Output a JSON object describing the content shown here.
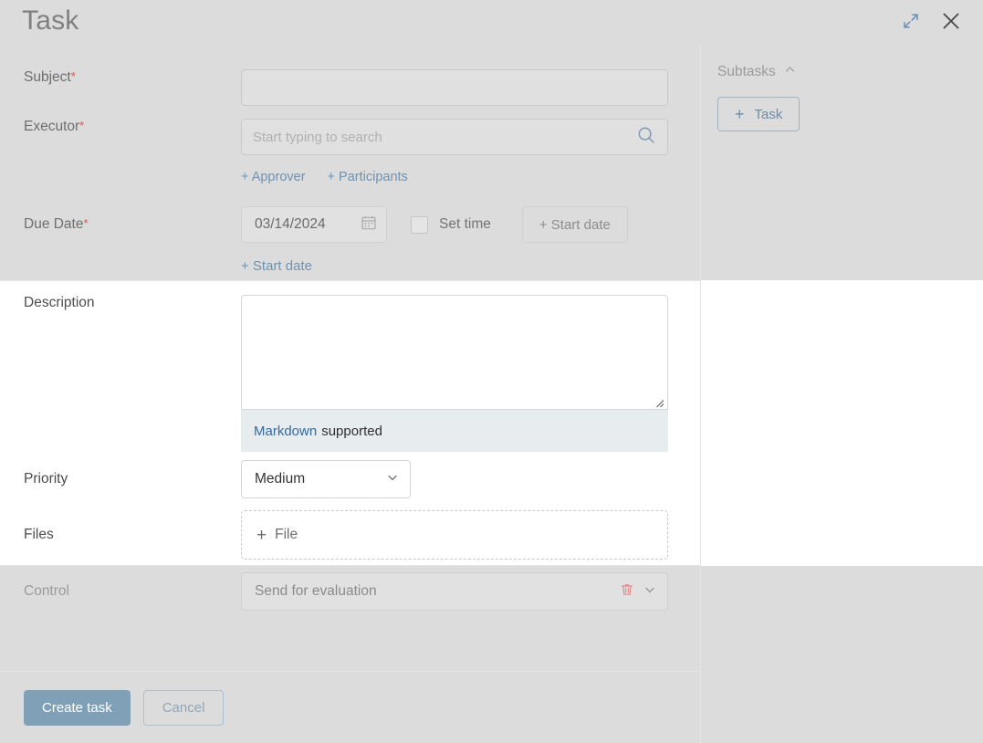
{
  "header": {
    "title": "Task",
    "expand_icon": "expand-diagonal-icon",
    "close_icon": "close-icon"
  },
  "form": {
    "subject": {
      "label": "Subject",
      "required_marker": "*",
      "value": "",
      "placeholder": ""
    },
    "executor": {
      "label": "Executor",
      "required_marker": "*",
      "value": "",
      "placeholder": "Start typing to search",
      "search_icon": "search-icon"
    },
    "people_links": [
      {
        "label": "+ Approver"
      },
      {
        "label": "+ Participants"
      }
    ],
    "due_date": {
      "label": "Due Date",
      "required_marker": "*",
      "value": "03/14/2024",
      "calendar_icon": "calendar-icon",
      "set_time_label": "Set time",
      "set_time_checked": false,
      "start_date_button": "+ Start date",
      "start_date_link": "+ Start date"
    },
    "description": {
      "label": "Description",
      "value": "",
      "markdown_link": "Markdown",
      "markdown_rest": "supported",
      "resize_grip": "resize-grip-icon"
    },
    "priority": {
      "label": "Priority",
      "value": "Medium",
      "chevron_icon": "chevron-down-icon",
      "options": [
        "Medium"
      ]
    },
    "files": {
      "label": "Files",
      "add_label": "File",
      "plus": "+"
    },
    "control": {
      "label": "Control",
      "value": "Send for evaluation",
      "delete_icon": "trash-icon",
      "chevron_icon": "chevron-down-icon"
    }
  },
  "footer": {
    "create_label": "Create task",
    "cancel_label": "Cancel"
  },
  "subtasks": {
    "title": "Subtasks",
    "collapse_icon": "chevron-up-icon",
    "add_task_label": "Task",
    "add_task_plus": "+"
  },
  "colors": {
    "accent": "#6d93b3",
    "primary_button": "#80a0b8",
    "required": "#d9534f",
    "markdown_link": "#35689c",
    "markdown_bar_bg": "#e7ecef",
    "dim_overlay": "#dcdcdc",
    "trash": "#e38b8b"
  }
}
